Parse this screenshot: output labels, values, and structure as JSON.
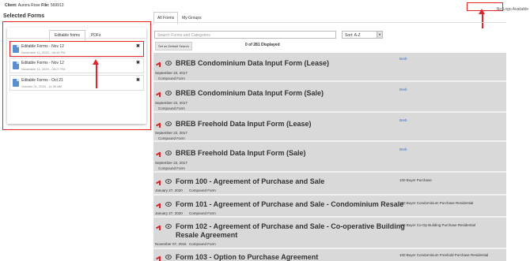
{
  "header": {
    "client_label": "Client:",
    "client_value": "Aurora Rose",
    "file_label": "File:",
    "file_value": "569913",
    "no_logo": "No Logo Available"
  },
  "left": {
    "title": "Selected Forms",
    "tabs": [
      "Editable forms",
      "PDFs"
    ],
    "items": [
      {
        "title": "Editable Forms - Nov 12",
        "date": "November 11, 2020 - 08:44 PM"
      },
      {
        "title": "Editable Forms - Nov 12",
        "date": "November 11, 2020 - 08:27 PM"
      },
      {
        "title": "Editable Forms - Oct 21",
        "date": "October 21, 2020 - 11:39 AM"
      }
    ]
  },
  "right": {
    "tabs": [
      "All Forms",
      "My Groups"
    ],
    "search_placeholder": "Search Forms and Categories",
    "sort_label": "Sort: A-Z",
    "default_button": "Set as Default Search",
    "count": "0 of 281 Displayed",
    "forms": [
      {
        "title": "BREB Condominium Data Input Form (Lease)",
        "date": "September 22, 2017",
        "category": "Compound Form",
        "tags": "Breb"
      },
      {
        "title": "BREB Condominium Data Input Form (Sale)",
        "date": "September 22, 2017",
        "category": "Compound Form",
        "tags": "Breb"
      },
      {
        "title": "BREB Freehold Data Input Form (Lease)",
        "date": "September 22, 2017",
        "category": "Compound Form",
        "tags": "Breb"
      },
      {
        "title": "BREB Freehold Data Input Form (Sale)",
        "date": "September 22, 2017",
        "category": "Compound Form",
        "tags": "Breb"
      },
      {
        "title": "Form 100 - Agreement of Purchase and Sale",
        "date": "January 27, 2020",
        "category": "Compound Form",
        "tags": "100  Buyer  Purchase"
      },
      {
        "title": "Form 101 - Agreement of Purchase and Sale - Condominium Resale",
        "date": "January 27, 2020",
        "category": "Compound Form",
        "tags": "100  Buyer  Condominium  Purchase  Residential"
      },
      {
        "title": "Form 102 - Agreement of Purchase and Sale - Co-operative Building Resale Agreement",
        "date": "November 07, 2016",
        "category": "Compound Form",
        "tags": "100  Buyer  Co-Op Building  Purchase  Residential"
      },
      {
        "title": "Form 103 - Option to Purchase Agreement",
        "date": "",
        "category": "",
        "tags": "100  Buyer  Condominium  Freehold  Purchase  Residential"
      }
    ]
  }
}
